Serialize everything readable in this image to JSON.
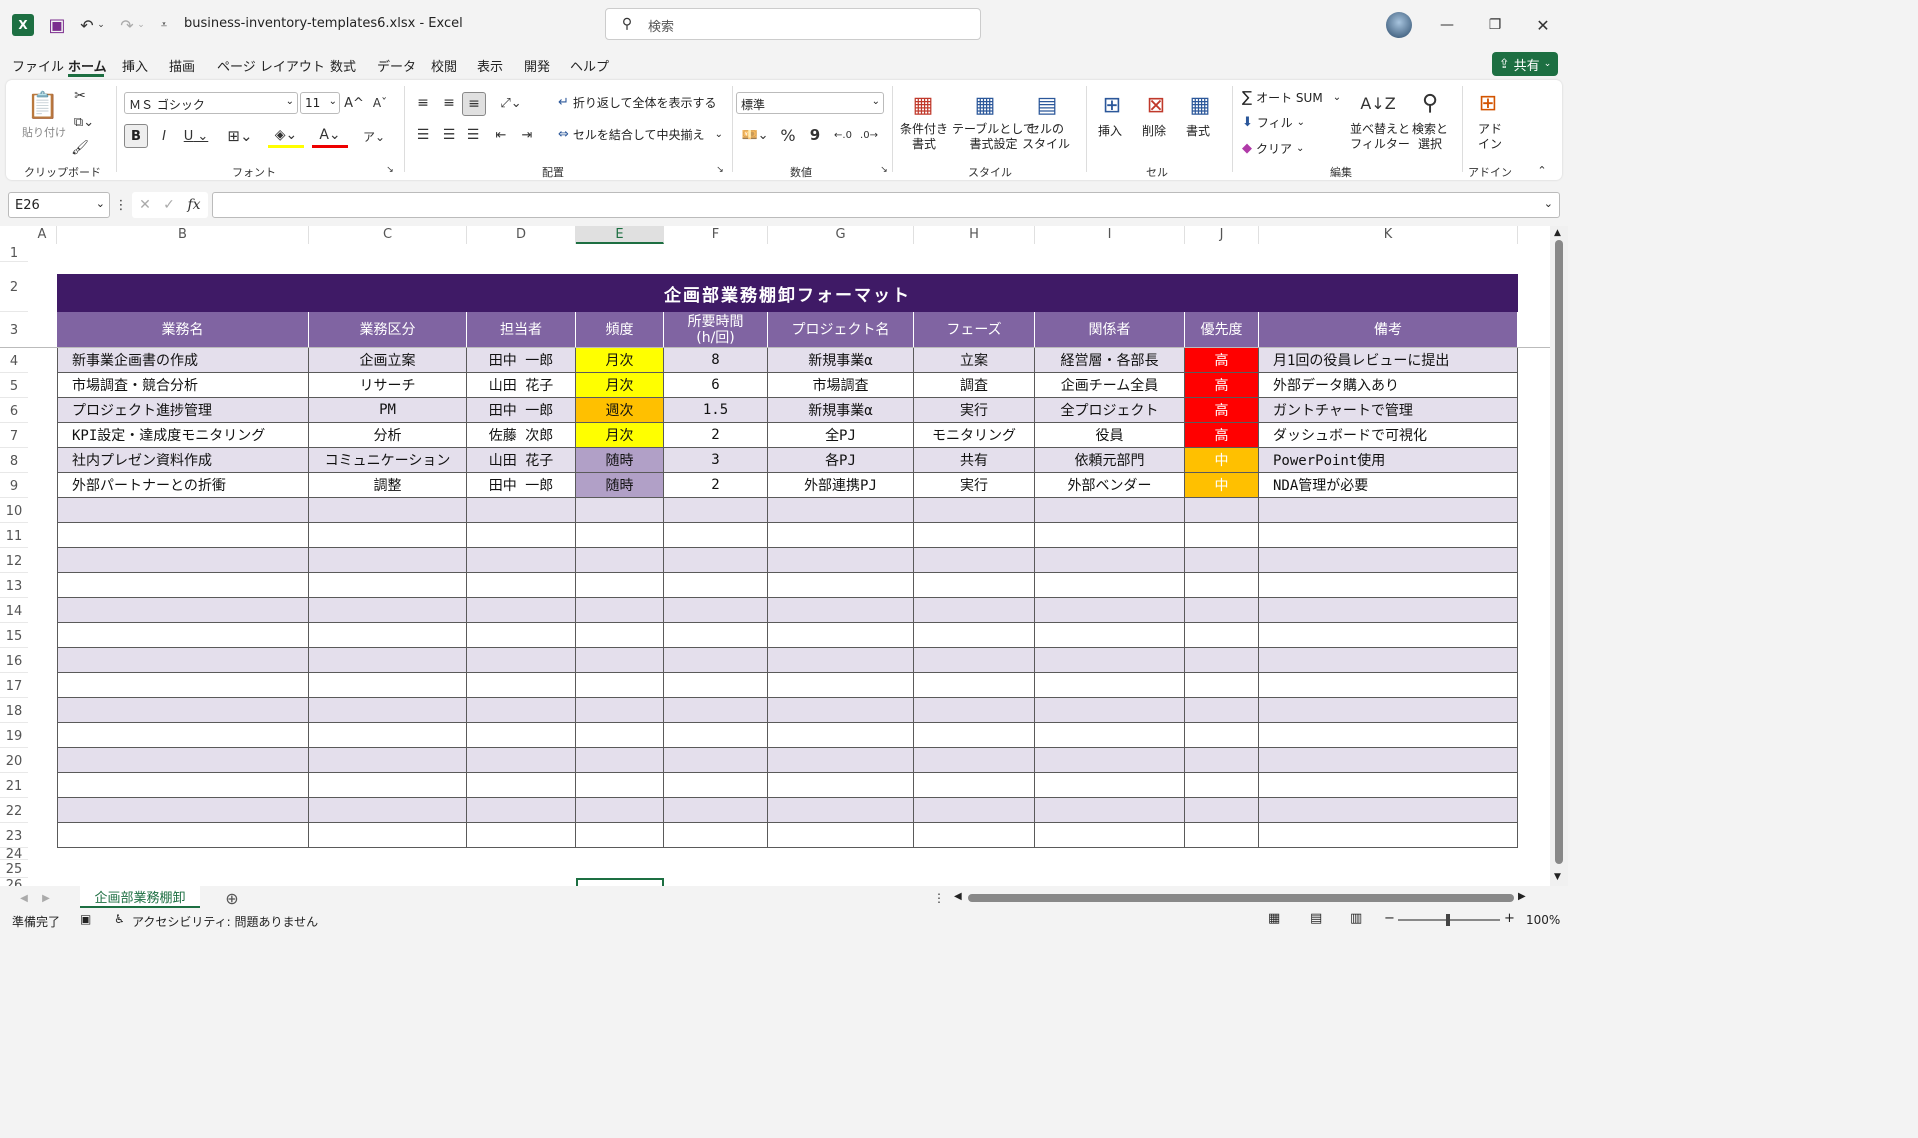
{
  "window": {
    "title": "business-inventory-templates6.xlsx  -  Excel",
    "search_placeholder": "検索",
    "share_label": "共有"
  },
  "menu": [
    "ファイル",
    "ホーム",
    "挿入",
    "描画",
    "ページ レイアウト",
    "数式",
    "データ",
    "校閲",
    "表示",
    "開発",
    "ヘルプ"
  ],
  "ribbon": {
    "clipboard": {
      "paste": "貼り付け",
      "group": "クリップボード"
    },
    "font": {
      "name": "ＭＳ ゴシック",
      "size": "11",
      "bold": "B",
      "italic": "I",
      "underline": "U",
      "group": "フォント"
    },
    "alignment": {
      "wrap": "折り返して全体を表示する",
      "merge": "セルを結合して中央揃え",
      "group": "配置"
    },
    "number": {
      "format": "標準",
      "percent": "%",
      "comma": "9",
      "group": "数値"
    },
    "styles": {
      "conditional": "条件付き\n書式",
      "table": "テーブルとして\n書式設定",
      "cell": "セルの\nスタイル",
      "group": "スタイル"
    },
    "cells": {
      "insert": "挿入",
      "delete": "削除",
      "format": "書式",
      "group": "セル"
    },
    "editing": {
      "autosum": "オート SUM",
      "fill": "フィル",
      "clear": "クリア",
      "sort": "並べ替えと\nフィルター",
      "find": "検索と\n選択",
      "group": "編集"
    },
    "addin": {
      "label": "アド\nイン",
      "group": "アドイン"
    }
  },
  "formula_bar": {
    "name_box": "E26",
    "fx": "fx",
    "value": ""
  },
  "columns": [
    "A",
    "B",
    "C",
    "D",
    "E",
    "F",
    "G",
    "H",
    "I",
    "J",
    "K"
  ],
  "rows": [
    "1",
    "2",
    "3",
    "4",
    "5",
    "6",
    "7",
    "8",
    "9",
    "10",
    "11",
    "12",
    "13",
    "14",
    "15",
    "16",
    "17",
    "18",
    "19",
    "20",
    "21",
    "22",
    "23",
    "24",
    "25",
    "26"
  ],
  "sheet": {
    "title": "企画部業務棚卸フォーマット",
    "headers": [
      "業務名",
      "業務区分",
      "担当者",
      "頻度",
      "所要時間\n(h/回)",
      "プロジェクト名",
      "フェーズ",
      "関係者",
      "優先度",
      "備考"
    ],
    "rows": [
      [
        "新事業企画書の作成",
        "企画立案",
        "田中 一郎",
        "月次",
        "8",
        "新規事業α",
        "立案",
        "経営層・各部長",
        "高",
        "月1回の役員レビューに提出"
      ],
      [
        "市場調査・競合分析",
        "リサーチ",
        "山田 花子",
        "月次",
        "6",
        "市場調査",
        "調査",
        "企画チーム全員",
        "高",
        "外部データ購入あり"
      ],
      [
        "プロジェクト進捗管理",
        "PM",
        "田中 一郎",
        "週次",
        "1.5",
        "新規事業α",
        "実行",
        "全プロジェクト",
        "高",
        "ガントチャートで管理"
      ],
      [
        "KPI設定・達成度モニタリング",
        "分析",
        "佐藤 次郎",
        "月次",
        "2",
        "全PJ",
        "モニタリング",
        "役員",
        "高",
        "ダッシュボードで可視化"
      ],
      [
        "社内プレゼン資料作成",
        "コミュニケーション",
        "山田 花子",
        "随時",
        "3",
        "各PJ",
        "共有",
        "依頼元部門",
        "中",
        "PowerPoint使用"
      ],
      [
        "外部パートナーとの折衝",
        "調整",
        "田中 一郎",
        "随時",
        "2",
        "外部連携PJ",
        "実行",
        "外部ベンダー",
        "中",
        "NDA管理が必要"
      ]
    ],
    "freq_colors": {
      "月次": "#ffff00",
      "週次": "#ffc000",
      "随時": "#b1a0c7"
    },
    "priority_colors": {
      "高": "#ff0000",
      "中": "#ffc000"
    },
    "title_color": "#3f1a66",
    "header_color": "#8064a2",
    "band_color": "#e4dfec"
  },
  "sheet_tab": "企画部業務棚卸",
  "status": {
    "ready": "準備完了",
    "accessibility": "アクセシビリティ: 問題ありません",
    "zoom": "100%"
  }
}
